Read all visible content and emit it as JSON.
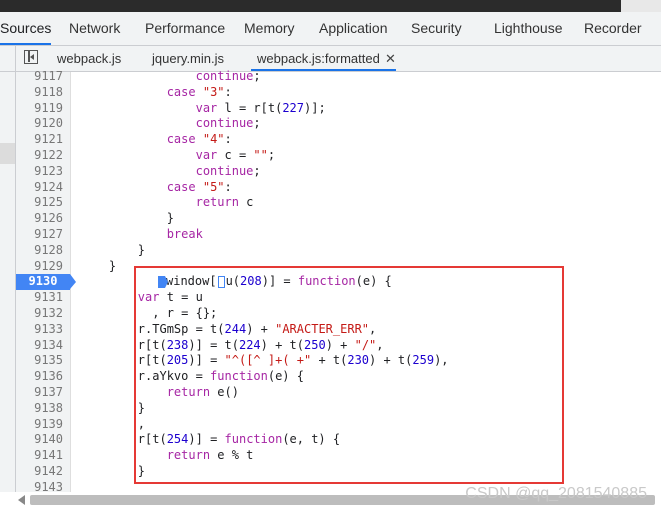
{
  "tabs": [
    "Sources",
    "Network",
    "Performance",
    "Memory",
    "Application",
    "Security",
    "Lighthouse",
    "Recorder"
  ],
  "files": {
    "tab1": "webpack.js",
    "tab2": "jquery.min.js",
    "tab3": "webpack.js:formatted",
    "close": "✕"
  },
  "code_lines": [
    {
      "n": "9117",
      "t": "                continue;"
    },
    {
      "n": "9118",
      "t": "            case \"3\":"
    },
    {
      "n": "9119",
      "t": "                var l = r[t(227)];"
    },
    {
      "n": "9120",
      "t": "                continue;"
    },
    {
      "n": "9121",
      "t": "            case \"4\":"
    },
    {
      "n": "9122",
      "t": "                var c = \"\";"
    },
    {
      "n": "9123",
      "t": "                continue;"
    },
    {
      "n": "9124",
      "t": "            case \"5\":"
    },
    {
      "n": "9125",
      "t": "                return c"
    },
    {
      "n": "9126",
      "t": "            }"
    },
    {
      "n": "9127",
      "t": "            break"
    },
    {
      "n": "9128",
      "t": "        }"
    },
    {
      "n": "9129",
      "t": "    }"
    },
    {
      "n": "9130",
      "t": "window[u(208)] = function(e) {",
      "current": true
    },
    {
      "n": "9131",
      "t": "        var t = u"
    },
    {
      "n": "9132",
      "t": "          , r = {};"
    },
    {
      "n": "9133",
      "t": "        r.TGmSp = t(244) + \"ARACTER_ERR\","
    },
    {
      "n": "9134",
      "t": "        r[t(238)] = t(224) + t(250) + \"/\","
    },
    {
      "n": "9135",
      "t": "        r[t(205)] = \"^([^ ]+( +\" + t(230) + t(259),"
    },
    {
      "n": "9136",
      "t": "        r.aYkvo = function(e) {"
    },
    {
      "n": "9137",
      "t": "            return e()"
    },
    {
      "n": "9138",
      "t": "        }"
    },
    {
      "n": "9139",
      "t": "        ,"
    },
    {
      "n": "9140",
      "t": "        r[t(254)] = function(e, t) {"
    },
    {
      "n": "9141",
      "t": "            return e % t"
    },
    {
      "n": "9142",
      "t": "        }"
    },
    {
      "n": "9143",
      "t": ""
    }
  ],
  "watermark": "CSDN @qq_2081540885"
}
